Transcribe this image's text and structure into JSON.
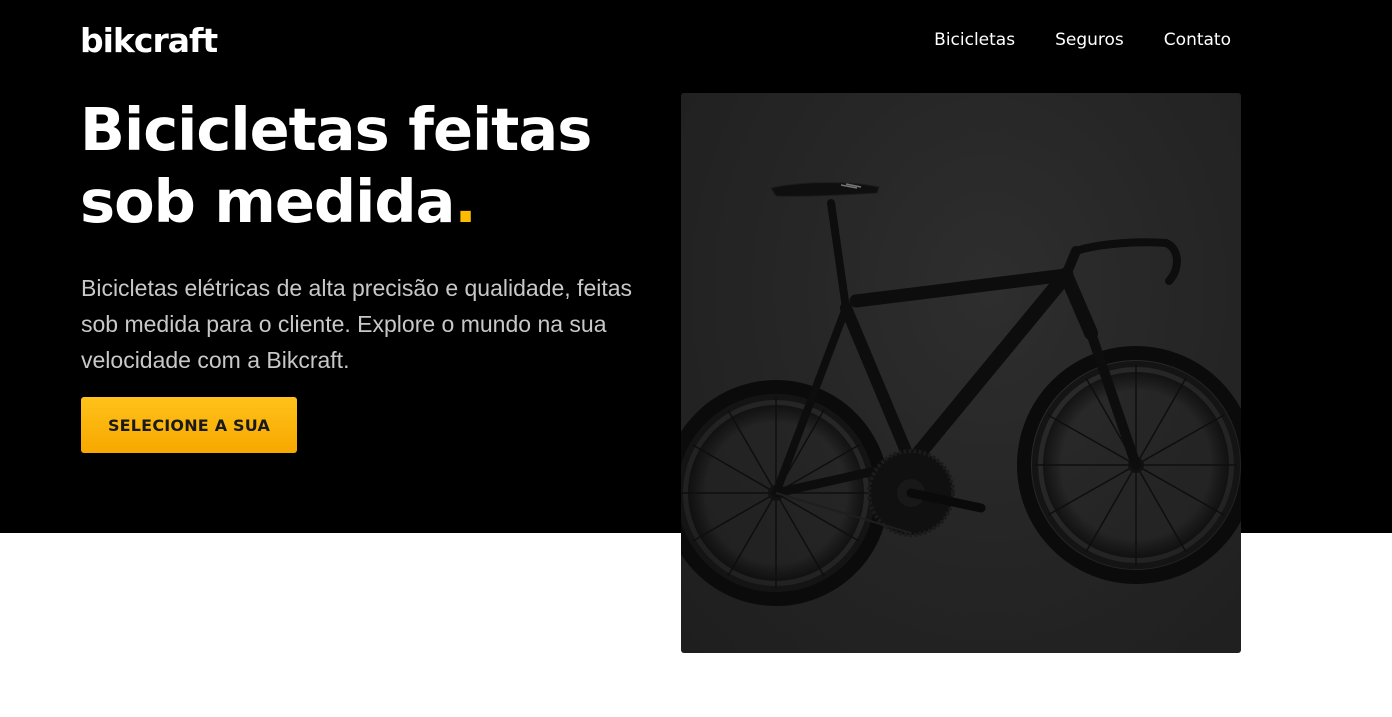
{
  "header": {
    "logo": "bikcraft",
    "nav": [
      {
        "label": "Bicicletas"
      },
      {
        "label": "Seguros"
      },
      {
        "label": "Contato"
      }
    ]
  },
  "hero": {
    "title_line1": "Bicicletas feitas",
    "title_line2": "sob medida",
    "title_dot": ".",
    "description": "Bicicletas elétricas de alta precisão e qualidade, feitas sob medida para o cliente. Explore o mundo na sua velocidade com a Bikcraft.",
    "cta_label": "SELECIONE A SUA"
  },
  "colors": {
    "accent": "#FFBB00",
    "hero_background": "#000000",
    "text_light": "#FFFFFF",
    "text_muted": "#C8C8C8"
  },
  "image": {
    "subject": "black road bicycle photo"
  }
}
